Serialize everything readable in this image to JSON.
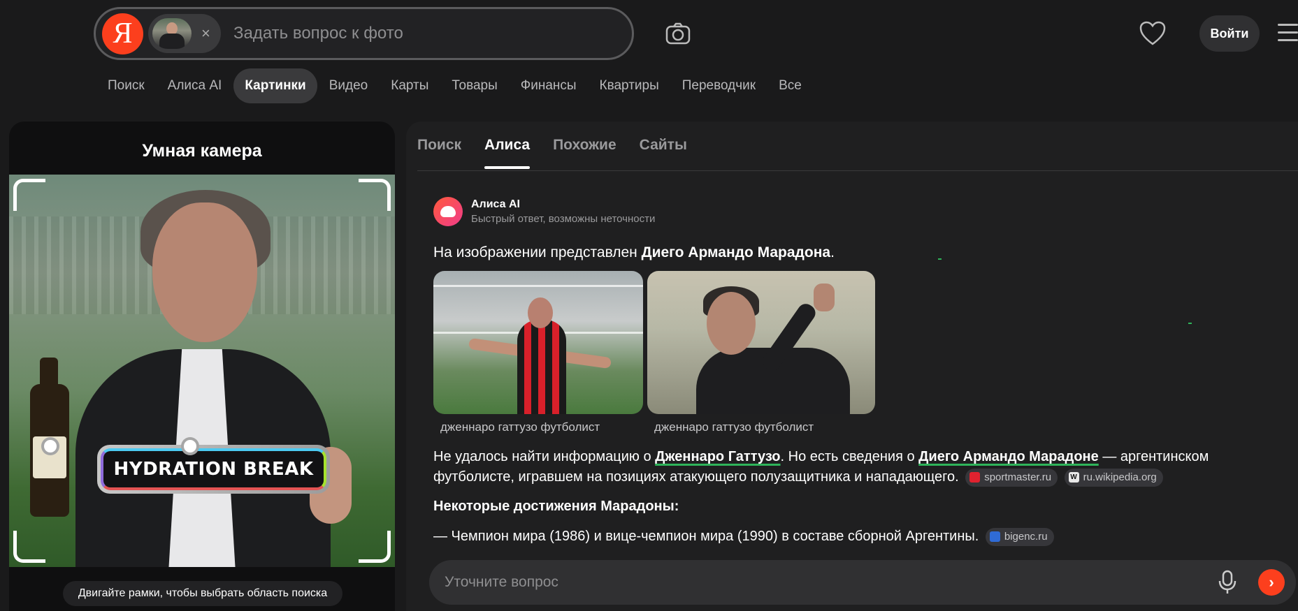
{
  "header": {
    "logo": "Я",
    "search_placeholder": "Задать вопрос к фото",
    "chip_close": "×",
    "login_label": "Войти",
    "icons": {
      "camera": "camera-icon",
      "heart": "heart-icon",
      "menu": "hamburger-icon"
    }
  },
  "nav": {
    "items": [
      "Поиск",
      "Алиса AI",
      "Картинки",
      "Видео",
      "Карты",
      "Товары",
      "Финансы",
      "Квартиры",
      "Переводчик",
      "Все"
    ],
    "active": "Картинки"
  },
  "left_panel": {
    "title": "Умная камера",
    "banner_text": "HYDRATION BREAK",
    "hint": "Двигайте рамки, чтобы выбрать область поиска"
  },
  "tabs": {
    "items": [
      "Поиск",
      "Алиса",
      "Похожие",
      "Сайты"
    ],
    "active": "Алиса"
  },
  "alice": {
    "name": "Алиса AI",
    "subtitle": "Быстрый ответ, возможны неточности",
    "answer_prefix": "На изображении представлен ",
    "answer_bold": "Диего Армандо Марадона",
    "answer_suffix": ".",
    "images": [
      {
        "caption": "дженнаро гаттузо футболист"
      },
      {
        "caption": "дженнаро гаттузо футболист"
      }
    ],
    "para1": {
      "t1": "Не удалось найти информацию о ",
      "link1": "Дженнаро Гаттузо",
      "t2": ". Но есть сведения о ",
      "link2": "Диего Армандо Марадоне",
      "t3": " — аргентинском футболисте, игравшем на позициях атакующего полузащитника и нападающего.",
      "src1": "sportmaster.ru",
      "src2": "ru.wikipedia.org"
    },
    "heading": "Некоторые достижения Марадоны:",
    "bullet": "—  Чемпион мира (1986) и вице-чемпион мира (1990) в составе сборной Аргентины.",
    "bullet_src": "bigenc.ru"
  },
  "ask": {
    "placeholder": "Уточните вопрос",
    "send": "›"
  }
}
